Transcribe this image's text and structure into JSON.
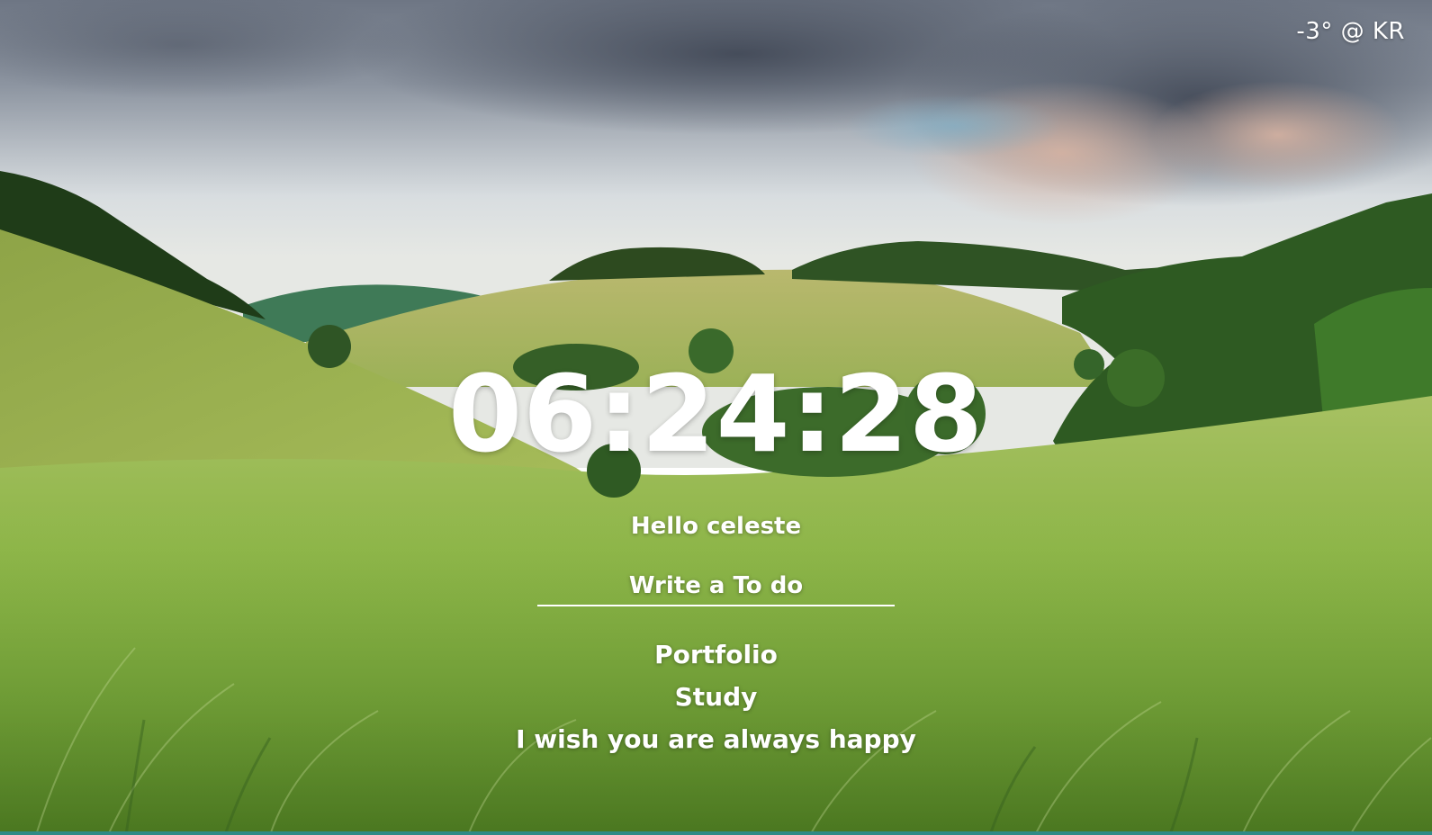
{
  "weather": {
    "text": "-3° @ KR"
  },
  "clock": {
    "time": "06:24:28"
  },
  "greeting": {
    "text": "Hello celeste"
  },
  "todo": {
    "placeholder": "Write a To do",
    "items": [
      "Portfolio",
      "Study",
      "I wish you are always happy"
    ]
  },
  "colors": {
    "sky_top": "#5b6a7e",
    "sky_light": "#d8dee2",
    "grass": "#8fb84a",
    "grass_dark": "#5f8f2c",
    "trees": "#2f5a22",
    "bottom_strip": "#2f8a86"
  },
  "background": {
    "icon": "landscape-background-image"
  }
}
